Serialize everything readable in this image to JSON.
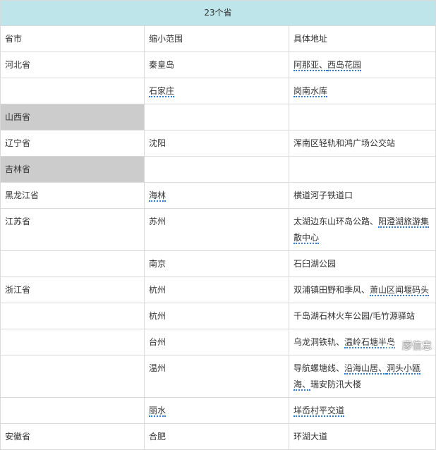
{
  "title": "23个省",
  "columns": [
    "省市",
    "缩小范围",
    "具体地址"
  ],
  "rows": [
    {
      "province": "河北省",
      "area": "秦皇岛",
      "address": [
        "阿那亚、",
        "西岛花园"
      ],
      "u_area": false,
      "u_addr": [
        true,
        true
      ]
    },
    {
      "province": "",
      "area": "石家庄",
      "address": [
        "岗南水库"
      ],
      "u_area": true,
      "u_addr": [
        true
      ]
    },
    {
      "province": "山西省",
      "area": "",
      "address": [],
      "gray": true
    },
    {
      "province": "辽宁省",
      "area": "沈阳",
      "address": [
        "浑南区轻轨和鸿广场公交站"
      ],
      "u_area": false,
      "u_addr": [
        false
      ]
    },
    {
      "province": "吉林省",
      "area": "",
      "address": [],
      "gray": true
    },
    {
      "province": "黑龙江省",
      "area": "海林",
      "address": [
        "横道河子铁道口"
      ],
      "u_area": true,
      "u_addr": [
        false
      ]
    },
    {
      "province": "江苏省",
      "area": "苏州",
      "address": [
        "太湖边东山环岛公路、",
        "阳澄湖旅游集散中心"
      ],
      "u_area": false,
      "u_addr": [
        false,
        true
      ],
      "tall": true
    },
    {
      "province": "",
      "area": "南京",
      "address": [
        "石臼湖公园"
      ],
      "u_area": false,
      "u_addr": [
        false
      ]
    },
    {
      "province": "浙江省",
      "area": "杭州",
      "address": [
        "双浦镇田野和季风、",
        "萧山区闻堰码头"
      ],
      "u_area": false,
      "u_addr": [
        false,
        true
      ]
    },
    {
      "province": "",
      "area": "杭州",
      "address": [
        "千岛湖石林火车公园/毛竹源驿站"
      ],
      "u_area": false,
      "u_addr": [
        false
      ]
    },
    {
      "province": "",
      "area": "台州",
      "address": [
        "乌龙洞铁轨、",
        "温岭石塘半岛"
      ],
      "u_area": false,
      "u_addr": [
        false,
        true
      ]
    },
    {
      "province": "",
      "area": "温州",
      "address": [
        "导航螺塘线、",
        "沿海山居、",
        "洞头小瓯海、",
        "瑞安防汛大楼"
      ],
      "u_area": false,
      "u_addr": [
        false,
        true,
        true,
        false
      ],
      "tall": true
    },
    {
      "province": "",
      "area": "丽水",
      "address": [
        "垟岙村平交道"
      ],
      "u_area": true,
      "u_addr": [
        true
      ]
    },
    {
      "province": "安徽省",
      "area": "合肥",
      "address": [
        "环湖大道"
      ],
      "u_area": false,
      "u_addr": [
        false
      ]
    }
  ],
  "watermark": {
    "text": "廖信忠",
    "icon": "weibo-icon"
  }
}
